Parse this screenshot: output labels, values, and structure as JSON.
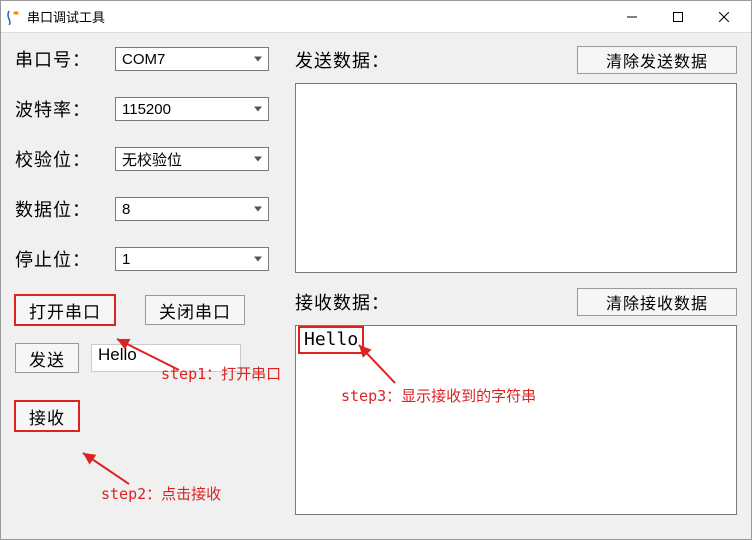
{
  "window": {
    "title": "串口调试工具"
  },
  "labels": {
    "port": "串口号：",
    "baud": "波特率：",
    "parity": "校验位：",
    "databits": "数据位：",
    "stopbits": "停止位："
  },
  "values": {
    "port": "COM7",
    "baud": "115200",
    "parity": "无校验位",
    "databits": "8",
    "stopbits": "1"
  },
  "buttons": {
    "open": "打开串口",
    "close": "关闭串口",
    "send": "发送",
    "receive": "接收",
    "clear_send": "清除发送数据",
    "clear_recv": "清除接收数据"
  },
  "right": {
    "send_label": "发送数据：",
    "recv_label": "接收数据："
  },
  "fields": {
    "send_input": "Hello",
    "send_area": "",
    "recv_area": "Hello"
  },
  "annotations": {
    "step1": "step1：打开串口",
    "step2": "step2：点击接收",
    "step3": "step3：显示接收到的字符串"
  }
}
